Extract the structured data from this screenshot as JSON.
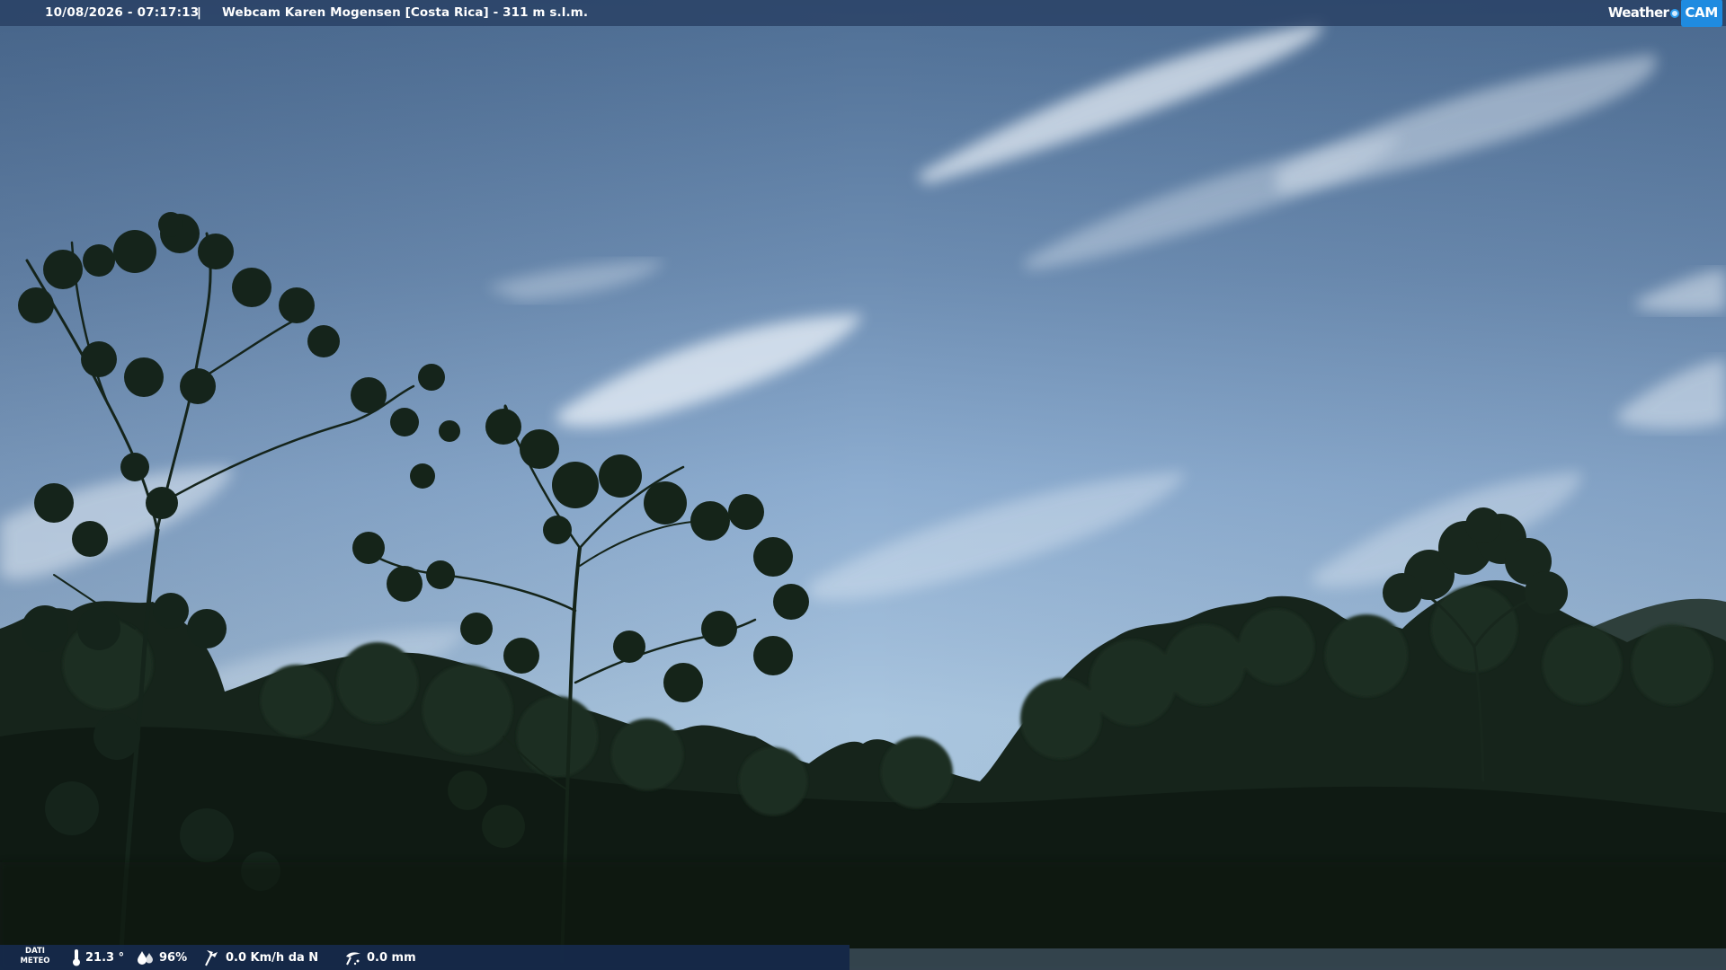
{
  "header": {
    "datetime": "10/08/2026 - 07:17:13",
    "separator": "|",
    "title": "Webcam Karen Mogensen [Costa Rica]  - 311 m s.l.m."
  },
  "logo": {
    "weather_text": "Weather",
    "cam_text": "CAM"
  },
  "weather_panel": {
    "label_line1": "DATI",
    "label_line2": "METEO",
    "temperature": "21.3 °",
    "humidity": "96%",
    "wind": "0.0 Km/h da N",
    "rain": "0.0 mm"
  },
  "icons": {
    "temperature": "thermometer-icon",
    "humidity": "humidity-icon",
    "wind": "wind-icon",
    "rain": "rain-gauge-icon"
  },
  "colors": {
    "header_bg": "#263e62",
    "footer_bg": "#162a4c",
    "logo_accent": "#1f8be0"
  }
}
